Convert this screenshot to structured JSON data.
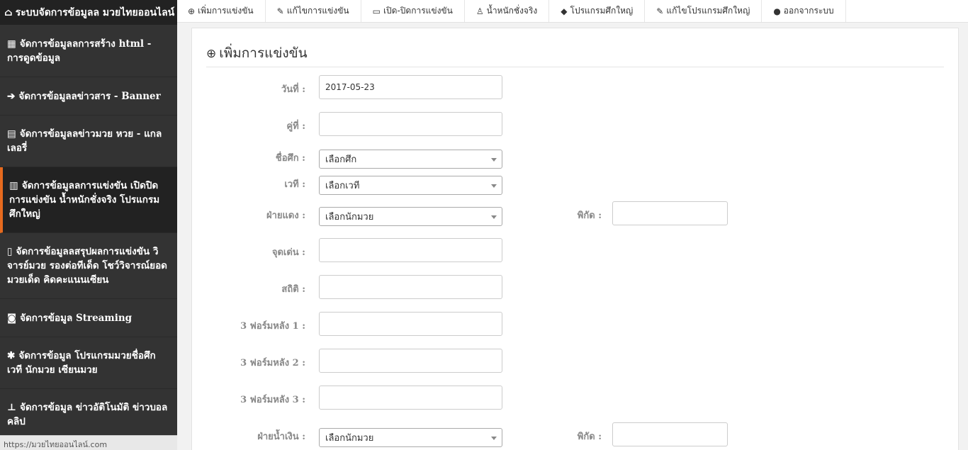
{
  "sidebar": {
    "brand": "ระบบจัดการข้อมูลล มวยไทยออนไลน์",
    "items": [
      {
        "icon": "grid-icon",
        "label": "จัดการข้อมูลลการสร้าง html - การดูดข้อมูล"
      },
      {
        "icon": "chevron-circle-right-icon",
        "label": "จัดการข้อมูลลข่าวสาร - Banner"
      },
      {
        "icon": "newspaper-icon",
        "label": "จัดการข้อมูลลข่าวมวย หวย - แกลเลอรี่"
      },
      {
        "icon": "bar-chart-icon",
        "label": "จัดการข้อมูลลการแข่งขัน เปิดปิดการแข่งขัน น้ำหนักชั่งจริง โปรแกรมศึกใหญ่"
      },
      {
        "icon": "file-icon",
        "label": "จัดการข้อมูลลสรุปผลการแข่งขัน วิจารย์มวย รองต่อทีเด็ด โชว์วิจารณ์ยอดมวยเด็ด คิดคะแนนเซียน"
      },
      {
        "icon": "camera-icon",
        "label": "จัดการข้อมูล Streaming"
      },
      {
        "icon": "gear-icon",
        "label": "จัดการข้อมูล โปรแกรมมวยชื่อศึก เวที นักมวย เซียนมวย"
      },
      {
        "icon": "sitemap-icon",
        "label": "จัดการข้อมูล ข่าวอัติโนมัติ ข่าวบอลคลิป"
      }
    ]
  },
  "status_url": "https://มวยไทยออนไลน์.com",
  "topnav": [
    {
      "icon": "plus-circle-icon",
      "label": "เพิ่มการแข่งขัน"
    },
    {
      "icon": "edit-icon",
      "label": "แก้ไขการแข่งขัน"
    },
    {
      "icon": "folder-open-icon",
      "label": "เปิด-ปิดการแข่งขัน"
    },
    {
      "icon": "weight-icon",
      "label": "น้ำหนักชั่งจริง"
    },
    {
      "icon": "tag-icon",
      "label": "โปรแกรมศึกใหญ่"
    },
    {
      "icon": "edit-icon",
      "label": "แก้ไขโปรแกรมศึกใหญ่"
    },
    {
      "icon": "user-icon",
      "label": "ออกจากระบบ"
    }
  ],
  "panel": {
    "title": "เพิ่มการแข่งขัน"
  },
  "form": {
    "date_label": "วันที่ :",
    "date_value": "2017-05-23",
    "pair_label": "คู่ที่ :",
    "event_label": "ชื่อศึก :",
    "event_selected": "เลือกศึก",
    "stadium_label": "เวที :",
    "stadium_selected": "เลือกเวที",
    "red_label": "ฝ่ายแดง :",
    "red_selected": "เลือกนักมวย",
    "red_odds_label": "พิกัด :",
    "highlight_label": "จุดเด่น :",
    "stats_label": "สถิติ :",
    "form1_label": "3 ฟอร์มหลัง 1 :",
    "form2_label": "3 ฟอร์มหลัง 2 :",
    "form3_label": "3 ฟอร์มหลัง 3 :",
    "blue_label": "ฝ่ายน้ำเงิน :",
    "blue_selected": "เลือกนักมวย",
    "blue_odds_label": "พิกัด :"
  }
}
